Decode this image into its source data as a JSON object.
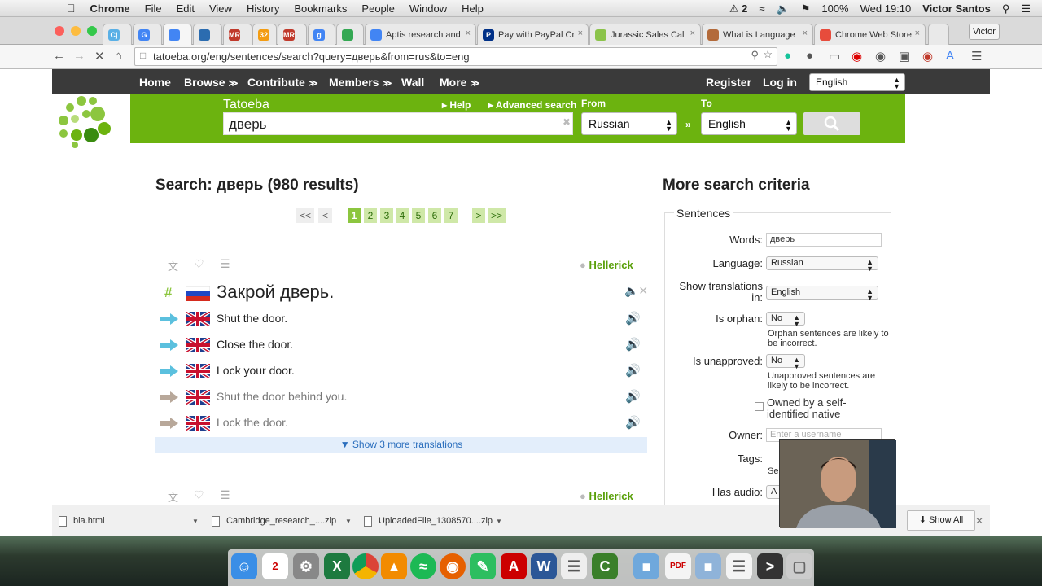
{
  "mac_menu": {
    "app": "Chrome",
    "items": [
      "File",
      "Edit",
      "View",
      "History",
      "Bookmarks",
      "People",
      "Window",
      "Help"
    ],
    "status": {
      "adobe": "2",
      "battery": "100%",
      "clock": "Wed 19:10",
      "user": "Victor Santos"
    }
  },
  "tabs": [
    {
      "label": "",
      "fav": "Cj",
      "color": "#5ab0e6"
    },
    {
      "label": "",
      "fav": "G",
      "color": "#4285f4"
    },
    {
      "label": "",
      "fav": "",
      "color": "#4285f4"
    },
    {
      "label": "",
      "fav": "",
      "color": "#2b6cb0"
    },
    {
      "label": "",
      "fav": "MR",
      "color": "#c0392b"
    },
    {
      "label": "",
      "fav": "32",
      "color": "#f39c12"
    },
    {
      "label": "",
      "fav": "MR",
      "color": "#c0392b"
    },
    {
      "label": "",
      "fav": "g",
      "color": "#4285f4"
    },
    {
      "label": "",
      "fav": "",
      "color": "#34a853"
    },
    {
      "label": "Aptis research and",
      "fav": "",
      "color": "#4285f4"
    },
    {
      "label": "Pay with PayPal Cr",
      "fav": "P",
      "color": "#003087"
    },
    {
      "label": "Jurassic Sales Cal",
      "fav": "",
      "color": "#8bc34a"
    },
    {
      "label": "What is Language",
      "fav": "",
      "color": "#b36a3a"
    },
    {
      "label": "Chrome Web Store",
      "fav": "",
      "color": "#e74c3c"
    }
  ],
  "profile": "Victor",
  "url": "tatoeba.org/eng/sentences/search?query=дверь&from=rus&to=eng",
  "nav": {
    "items": [
      "Home",
      "Browse",
      "Contribute",
      "Members",
      "Wall",
      "More"
    ],
    "register": "Register",
    "login": "Log in",
    "ui_language": "English"
  },
  "searchbar": {
    "brand": "Tatoeba",
    "query": "дверь",
    "help": "Help",
    "advanced": "Advanced search",
    "from_label": "From",
    "from": "Russian",
    "to_label": "To",
    "to": "English"
  },
  "results": {
    "title": "Search: дверь (980 results)",
    "pages": [
      "1",
      "2",
      "3",
      "4",
      "5",
      "6",
      "7"
    ],
    "prev_all": "<<",
    "prev": "<",
    "next": ">",
    "next_all": ">>"
  },
  "sentence1": {
    "owner": "Hellerick",
    "text": "Закрой дверь.",
    "hash": "#",
    "translations": [
      {
        "text": "Shut the door.",
        "direct": true
      },
      {
        "text": "Close the door.",
        "direct": true
      },
      {
        "text": "Lock your door.",
        "direct": true
      },
      {
        "text": "Shut the door behind you.",
        "direct": false
      },
      {
        "text": "Lock the door.",
        "direct": false
      }
    ],
    "more": "Show 3 more translations"
  },
  "sentence2": {
    "owner": "Hellerick"
  },
  "criteria": {
    "title": "More search criteria",
    "legend": "Sentences",
    "words_label": "Words:",
    "words": "дверь",
    "language_label": "Language:",
    "language": "Russian",
    "show_tr_label": "Show translations in:",
    "show_tr": "English",
    "orphan_label": "Is orphan:",
    "orphan": "No",
    "orphan_note": "Orphan sentences are likely to be incorrect.",
    "unapproved_label": "Is unapproved:",
    "unapproved": "No",
    "unapproved_note": "Unapproved sentences are likely to be incorrect.",
    "owned_label": "Owned by a self-identified native",
    "owner_label": "Owner:",
    "owner_placeholder": "Enter a username",
    "tags_label": "Tags:",
    "tags_hint": "Sep",
    "audio_label": "Has audio:",
    "audio": "A"
  },
  "downloads": [
    {
      "name": "bla.html"
    },
    {
      "name": "Cambridge_research_....zip"
    },
    {
      "name": "UploadedFile_1308570....zip"
    }
  ],
  "show_all": "Show All",
  "colors": {
    "tatoeba_green": "#6cb30f",
    "nav": "#3a3a3a",
    "arrow_direct": "#5bc0de",
    "arrow_indirect": "#b8a89a"
  }
}
